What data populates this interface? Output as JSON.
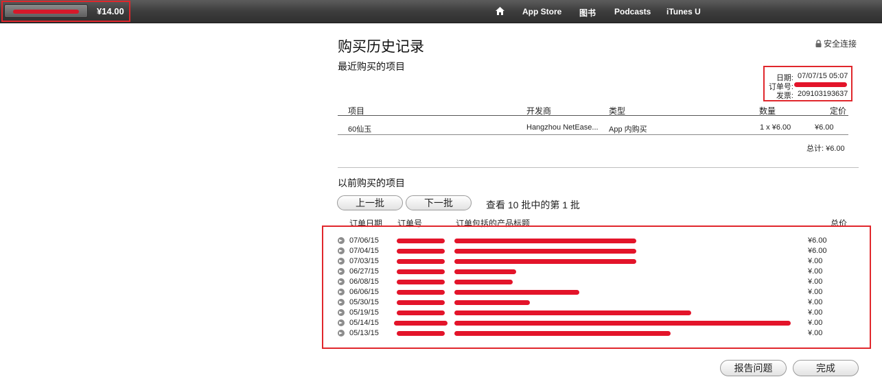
{
  "topbar": {
    "balance": "¥14.00",
    "nav": [
      "App Store",
      "图书",
      "Podcasts",
      "iTunes U"
    ]
  },
  "header": {
    "title": "购买历史记录",
    "secure": "安全连接",
    "recent_heading": "最近购买的项目"
  },
  "order_info": {
    "date_label": "日期:",
    "date": "07/07/15 05:07",
    "order_label": "订单号:",
    "invoice_label": "发票:",
    "invoice": "209103193637"
  },
  "recent_table": {
    "columns": [
      "项目",
      "开发商",
      "类型",
      "数量",
      "定价"
    ],
    "rows": [
      {
        "item": "60仙玉",
        "developer": "Hangzhou NetEase...",
        "type": "App 内购买",
        "qty": "1 x ¥6.00",
        "price": "¥6.00"
      }
    ],
    "total": "总计: ¥6.00"
  },
  "history": {
    "heading": "以前购买的项目",
    "prev_label": "上一批",
    "next_label": "下一批",
    "batch_text": "查看 10 批中的第 1 批",
    "columns": [
      "订单日期",
      "订单号",
      "订单包括的产品标题",
      "总价"
    ],
    "rows": [
      {
        "date": "07/06/15",
        "total": "¥6.00"
      },
      {
        "date": "07/04/15",
        "total": "¥6.00"
      },
      {
        "date": "07/03/15",
        "total": "¥.00"
      },
      {
        "date": "06/27/15",
        "total": "¥.00"
      },
      {
        "date": "06/08/15",
        "total": "¥.00"
      },
      {
        "date": "06/06/15",
        "total": "¥.00"
      },
      {
        "date": "05/30/15",
        "total": "¥.00"
      },
      {
        "date": "05/19/15",
        "total": "¥.00"
      },
      {
        "date": "05/14/15",
        "total": "¥.00"
      },
      {
        "date": "05/13/15",
        "total": "¥.00"
      }
    ]
  },
  "footer": {
    "report_label": "报告问题",
    "done_label": "完成"
  },
  "colors": {
    "highlight_red": "#e0262b",
    "redaction_red": "#e3142a",
    "topbar_dark": "#3d3d3d"
  }
}
